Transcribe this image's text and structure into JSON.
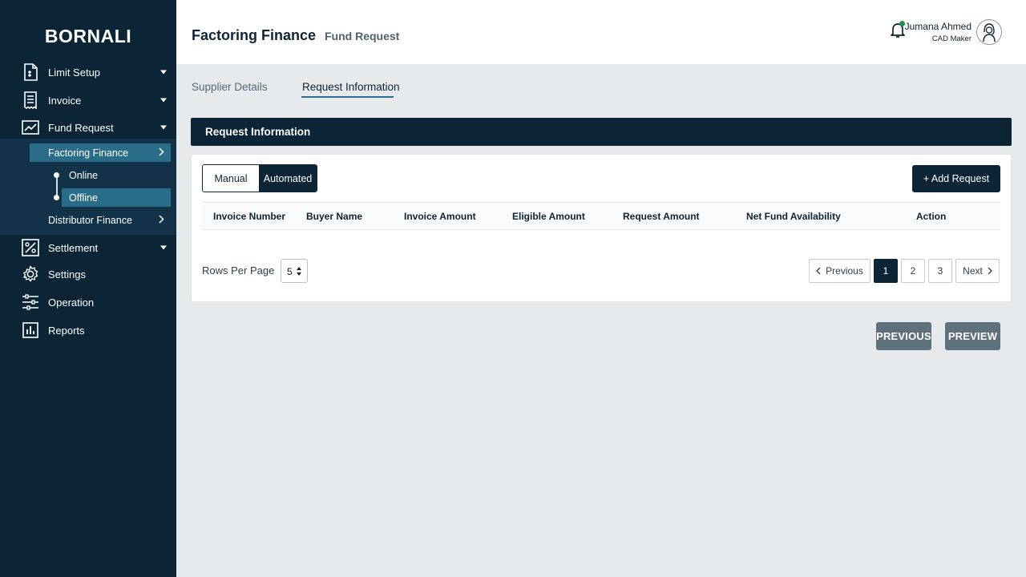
{
  "brand": "BORNALI",
  "sidebar": {
    "items": [
      {
        "label": "Limit Setup",
        "icon": "document-icon"
      },
      {
        "label": "Invoice",
        "icon": "receipt-icon"
      },
      {
        "label": "Fund Request",
        "icon": "chart-icon"
      },
      {
        "label": "Settlement",
        "icon": "percent-icon"
      },
      {
        "label": "Settings",
        "icon": "gear-icon"
      },
      {
        "label": "Operation",
        "icon": "sliders-icon"
      },
      {
        "label": "Reports",
        "icon": "bar-chart-icon"
      }
    ],
    "fund_request_sub": {
      "factoring": "Factoring Finance",
      "online": "Online",
      "offline": "Offline",
      "distributor": "Distributor Finance"
    }
  },
  "header": {
    "title": "Factoring Finance",
    "subtitle": "Fund Request",
    "user_name": "Jumana Ahmed",
    "user_role": "CAD Maker"
  },
  "tabs": [
    {
      "label": "Supplier Details",
      "active": false
    },
    {
      "label": "Request Information",
      "active": true
    }
  ],
  "section_title": "Request Information",
  "mode_toggle": {
    "manual": "Manual",
    "automated": "Automated",
    "selected": "Automated"
  },
  "add_button": "+ Add Request",
  "table": {
    "columns": [
      "Invoice Number",
      "Buyer Name",
      "Invoice Amount",
      "Eligible Amount",
      "Request Amount",
      "Net Fund Availability",
      "Action"
    ],
    "rows": []
  },
  "pagination": {
    "rows_per_page_label": "Rows Per Page",
    "rows_per_page": "5",
    "previous": "Previous",
    "pages": [
      "1",
      "2",
      "3"
    ],
    "current_page": "1",
    "next": "Next"
  },
  "footer_buttons": {
    "previous": "PREVIOUS",
    "preview": "PREVIEW"
  },
  "colors": {
    "navy": "#0b2436",
    "active_sub": "#2a6d89",
    "notify": "#1f8f4e",
    "muted_button": "#5f707d"
  }
}
